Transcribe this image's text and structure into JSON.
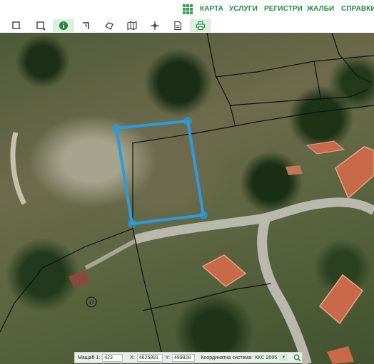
{
  "nav": {
    "menu_icon": "grid-menu-icon",
    "items": [
      "КАРТА",
      "УСЛУГИ",
      "РЕГИСТРИ",
      "ЖАЛБИ",
      "СПРАВКИ"
    ]
  },
  "toolbar": {
    "tools": [
      {
        "icon": "square-select-icon"
      },
      {
        "icon": "rect-select-icon"
      },
      {
        "icon": "info-icon",
        "active": true
      },
      {
        "icon": "corner-measure-icon"
      },
      {
        "icon": "polygon-measure-icon"
      },
      {
        "icon": "map-layers-icon"
      },
      {
        "icon": "coordinate-point-icon"
      },
      {
        "icon": "document-icon"
      },
      {
        "icon": "print-icon",
        "active": true
      }
    ]
  },
  "map": {
    "parcel_label": "17"
  },
  "status": {
    "scale_label": "Мащаб 1:",
    "scale_value": "423",
    "x_label": "X:",
    "x_value": "4625891",
    "y_label": "Y:",
    "y_value": "489828",
    "crs_label": "Координатна система:",
    "crs_value": "ККС 2005"
  },
  "colors": {
    "brand_green": "#1f8a3c",
    "selection_blue": "#2b9be0"
  }
}
